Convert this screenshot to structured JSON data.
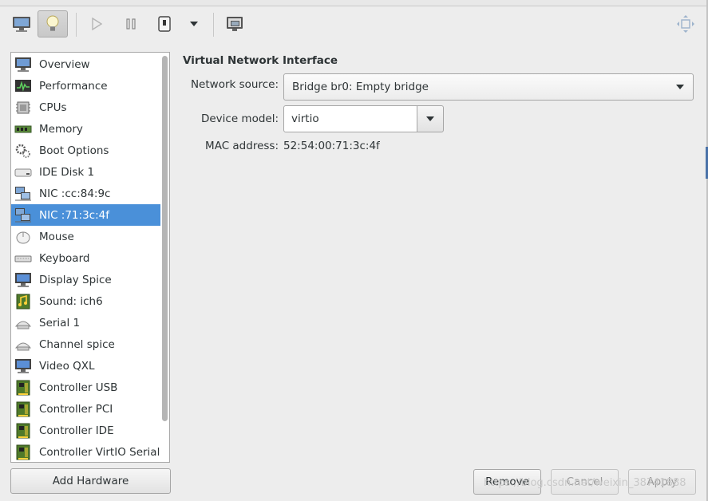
{
  "toolbar": {
    "buttons": [
      {
        "name": "console-icon"
      },
      {
        "name": "details-bulb-icon",
        "active": true
      },
      {
        "name": "run-icon"
      },
      {
        "name": "pause-icon"
      },
      {
        "name": "shutdown-icon"
      },
      {
        "name": "dropdown-arrow-icon"
      },
      {
        "name": "snapshots-icon"
      },
      {
        "name": "fullscreen-icon"
      }
    ]
  },
  "sidebar": {
    "items": [
      {
        "label": "Overview",
        "icon": "monitor-icon"
      },
      {
        "label": "Performance",
        "icon": "performance-icon"
      },
      {
        "label": "CPUs",
        "icon": "cpu-icon"
      },
      {
        "label": "Memory",
        "icon": "memory-icon"
      },
      {
        "label": "Boot Options",
        "icon": "gears-icon"
      },
      {
        "label": "IDE Disk 1",
        "icon": "disk-icon"
      },
      {
        "label": "NIC :cc:84:9c",
        "icon": "network-icon"
      },
      {
        "label": "NIC :71:3c:4f",
        "icon": "network-icon",
        "selected": true
      },
      {
        "label": "Mouse",
        "icon": "mouse-icon"
      },
      {
        "label": "Keyboard",
        "icon": "keyboard-icon"
      },
      {
        "label": "Display Spice",
        "icon": "display-icon"
      },
      {
        "label": "Sound: ich6",
        "icon": "sound-card-icon"
      },
      {
        "label": "Serial 1",
        "icon": "serial-icon"
      },
      {
        "label": "Channel spice",
        "icon": "channel-icon"
      },
      {
        "label": "Video QXL",
        "icon": "video-icon"
      },
      {
        "label": "Controller USB",
        "icon": "controller-icon"
      },
      {
        "label": "Controller PCI",
        "icon": "controller-icon"
      },
      {
        "label": "Controller IDE",
        "icon": "controller-icon"
      },
      {
        "label": "Controller VirtIO Serial",
        "icon": "controller-icon"
      }
    ],
    "add_hardware_label": "Add Hardware"
  },
  "main": {
    "section_title": "Virtual Network Interface",
    "network_source_label": "Network source:",
    "network_source_value": "Bridge br0: Empty bridge",
    "device_model_label": "Device model:",
    "device_model_value": "virtio",
    "mac_label": "MAC address:",
    "mac_value": "52:54:00:71:3c:4f"
  },
  "footer": {
    "remove_label": "Remove",
    "cancel_label": "Cancel",
    "apply_label": "Apply"
  },
  "watermark": "https://blog.csdn.net/weixin_38741888",
  "colors": {
    "selection": "#4a90d9",
    "background": "#ededed"
  }
}
